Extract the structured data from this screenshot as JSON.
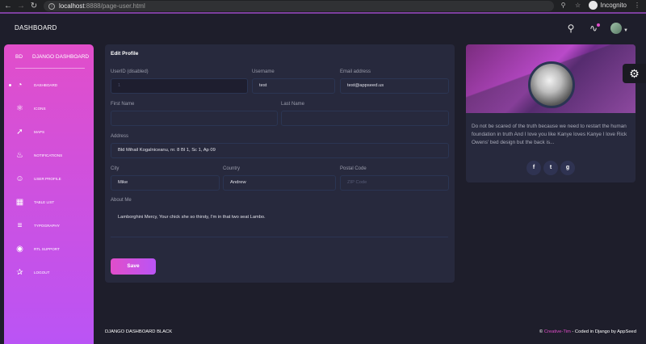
{
  "browser": {
    "url_host": "localhost",
    "url_path": ":8888/page-user.html",
    "mode_label": "Incognito"
  },
  "navbar": {
    "brand": "DASHBOARD"
  },
  "sidebar": {
    "logo_mini": "BD",
    "logo_text": "DJANGO DASHBOARD",
    "items": [
      {
        "label": "DASHBOARD",
        "icon": "chart-pie-icon",
        "active": true
      },
      {
        "label": "ICONS",
        "icon": "atom-icon"
      },
      {
        "label": "MAPS",
        "icon": "pin-icon"
      },
      {
        "label": "NOTIFICATIONS",
        "icon": "bell-icon"
      },
      {
        "label": "USER PROFILE",
        "icon": "single-user-icon"
      },
      {
        "label": "TABLE LIST",
        "icon": "puzzle-icon"
      },
      {
        "label": "TYPOGRAPHY",
        "icon": "align-icon"
      },
      {
        "label": "RTL SUPPORT",
        "icon": "world-icon"
      },
      {
        "label": "LOGOUT",
        "icon": "user-run-icon"
      }
    ]
  },
  "edit_profile": {
    "title": "Edit Profile",
    "userid": {
      "label": "UserID (disabled)",
      "value": "1"
    },
    "username": {
      "label": "Username",
      "value": "test"
    },
    "email": {
      "label": "Email address",
      "value": "test@appseed.us"
    },
    "first_name": {
      "label": "First Name",
      "value": ""
    },
    "last_name": {
      "label": "Last Name",
      "value": ""
    },
    "address": {
      "label": "Address",
      "value": "Bld Mihail Kogalniceanu, nr. 8 Bl 1, Sc 1, Ap 09"
    },
    "city": {
      "label": "City",
      "value": "Mike"
    },
    "country": {
      "label": "Country",
      "value": "Andrew"
    },
    "postal": {
      "label": "Postal Code",
      "placeholder": "ZIP Code"
    },
    "about": {
      "label": "About Me",
      "value": "Lamborghini Mercy, Your chick she so thirsty, I'm in that two seat Lambo."
    },
    "save_label": "Save"
  },
  "profile_card": {
    "description": "Do not be scared of the truth because we need to restart the human foundation in truth And I love you like Kanye loves Kanye I love Rick Owens' bed design but the back is...",
    "social": [
      "facebook-icon",
      "twitter-icon",
      "google-icon"
    ]
  },
  "footer": {
    "left": "DJANGO DASHBOARD BLACK",
    "copyright": "©",
    "link": "Creative-Tim",
    "rest": " - Coded in Django by AppSeed"
  },
  "colors": {
    "accent": "#e14eca",
    "accent2": "#ba54f5",
    "card": "#27293d",
    "bg": "#1e1e2b"
  }
}
